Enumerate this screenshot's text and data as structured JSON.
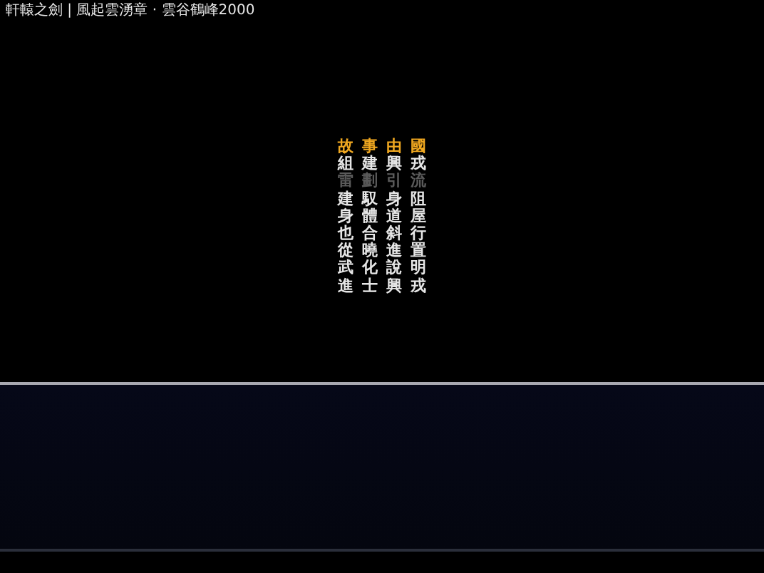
{
  "title": "軒轅之劍 | 風起雲湧章 · 雲谷鶴峰2000",
  "credits": [
    {
      "text": "故事由國",
      "kind": "highlight"
    },
    {
      "text": "組建興戎",
      "kind": "normal"
    },
    {
      "text": "雷劃引流",
      "kind": "dim"
    },
    {
      "text": "建馭身阻",
      "kind": "normal"
    },
    {
      "text": "身體道屋",
      "kind": "normal"
    },
    {
      "text": "也合斜行",
      "kind": "normal"
    },
    {
      "text": "從曉進置",
      "kind": "normal"
    },
    {
      "text": "武化說明",
      "kind": "normal"
    },
    {
      "text": "進士興戎",
      "kind": "normal"
    }
  ]
}
